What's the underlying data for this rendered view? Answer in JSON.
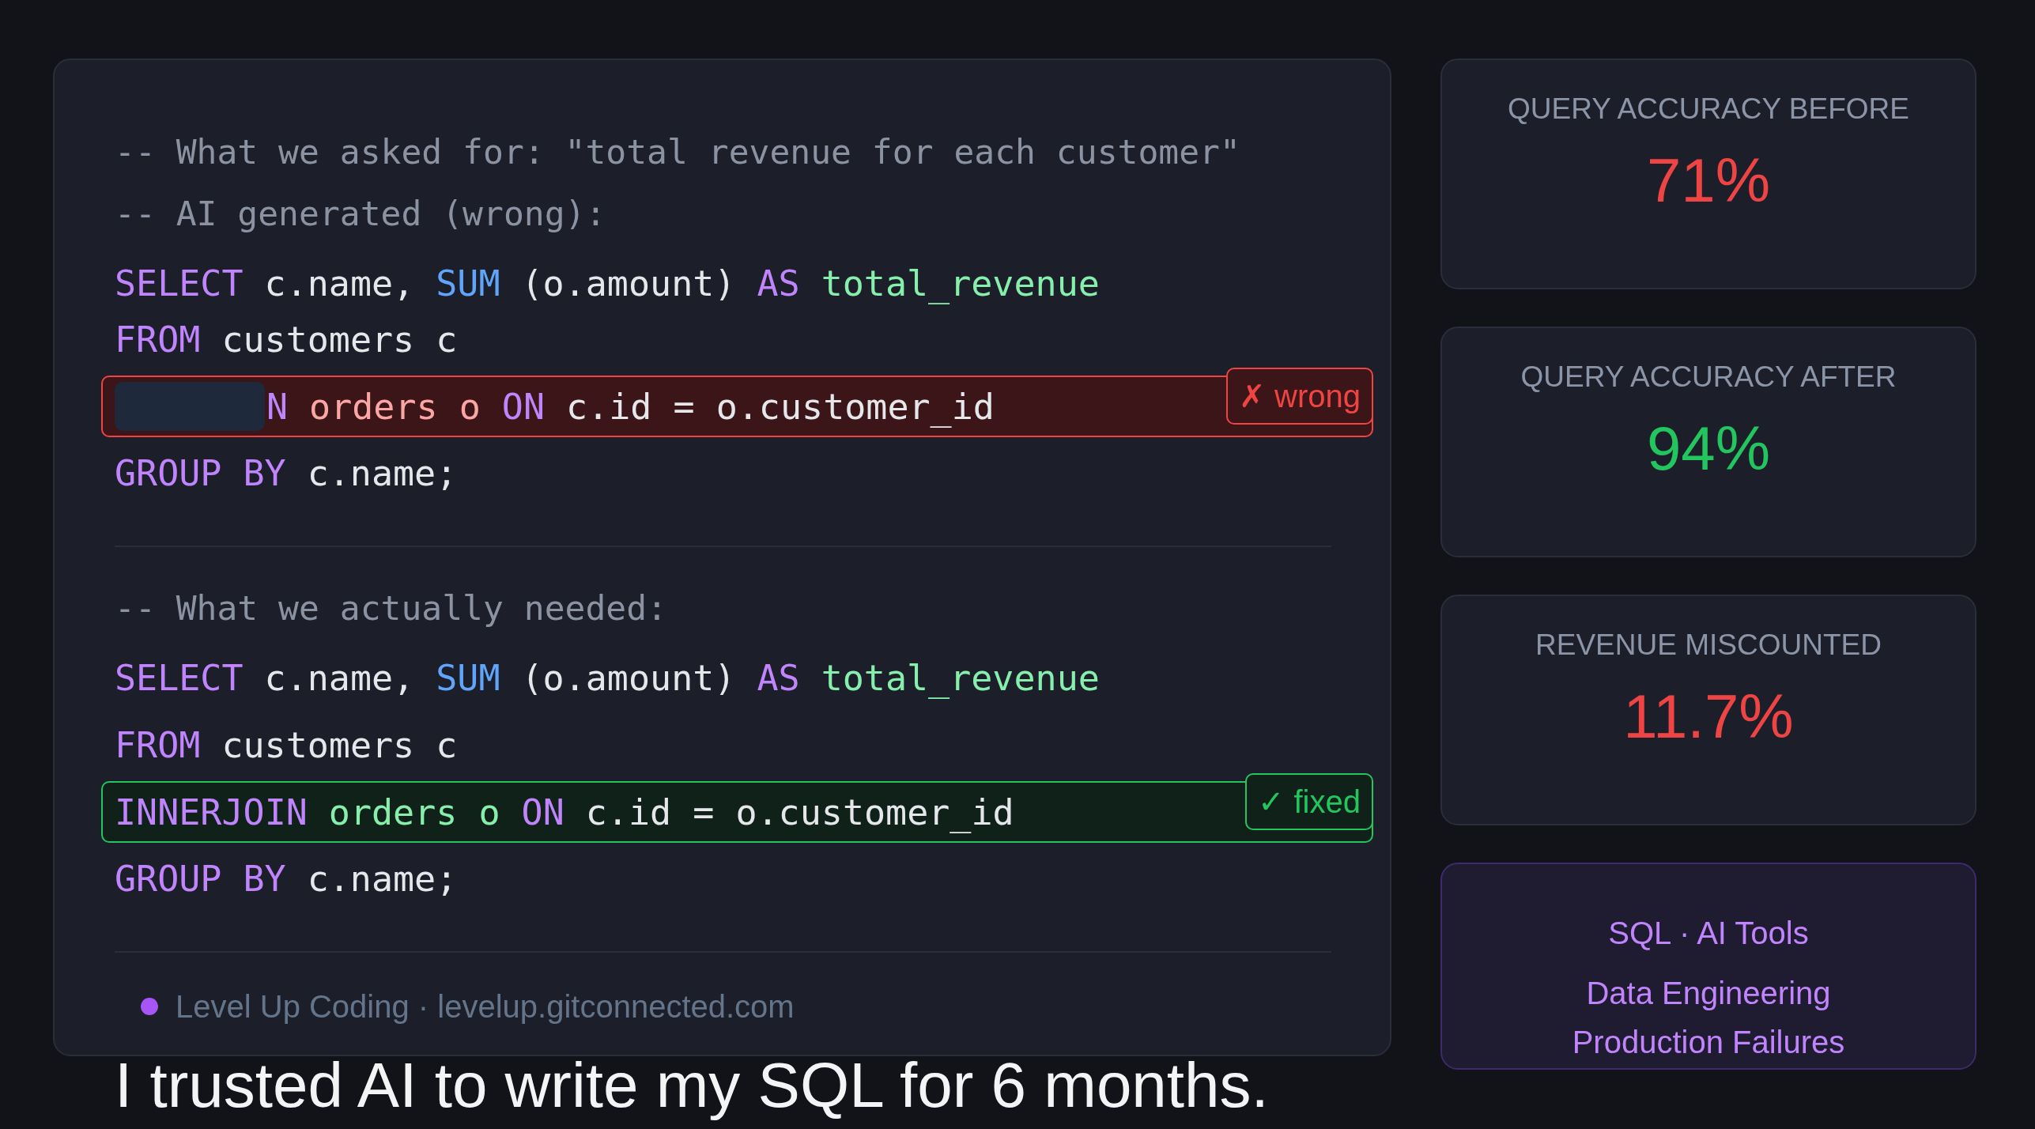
{
  "code_panel": {
    "sections": [
      {
        "lines": [
          {
            "kind": "comment",
            "text": "-- What we asked for: \"total revenue for each customer\""
          },
          {
            "kind": "comment",
            "text": "-- AI generated (wrong):"
          },
          {
            "kind": "code",
            "tokens": [
              {
                "text": "SELECT",
                "kind": "keyword"
              },
              {
                "text": "c.name,",
                "kind": "plain"
              },
              {
                "text": "SUM",
                "kind": "function"
              },
              {
                "text": "(o.amount)",
                "kind": "plain"
              },
              {
                "text": "AS",
                "kind": "keyword"
              },
              {
                "text": "total_revenue",
                "kind": "alias"
              }
            ]
          },
          {
            "kind": "code",
            "tokens": [
              {
                "text": "FROM",
                "kind": "keyword"
              },
              {
                "text": "customers c",
                "kind": "plain"
              }
            ]
          },
          {
            "kind": "highlight",
            "correct": false,
            "badge": "✗ wrong",
            "redacted": true,
            "tokens": [
              {
                "text": "N",
                "kind": "keyword"
              },
              {
                "text": "orders o",
                "kind": "error"
              },
              {
                "text": "ON",
                "kind": "keyword"
              },
              {
                "text": "c.id = o.customer_id",
                "kind": "plain"
              }
            ]
          },
          {
            "kind": "code",
            "tokens": [
              {
                "text": "GROUP",
                "kind": "keyword"
              },
              {
                "text": "BY",
                "kind": "keyword"
              },
              {
                "text": "c.name;",
                "kind": "plain"
              }
            ]
          }
        ]
      },
      {
        "lines": [
          {
            "kind": "comment",
            "text": "-- What we actually needed:"
          },
          {
            "kind": "code",
            "tokens": [
              {
                "text": "SELECT",
                "kind": "keyword"
              },
              {
                "text": "c.name,",
                "kind": "plain"
              },
              {
                "text": "SUM",
                "kind": "function"
              },
              {
                "text": "(o.amount)",
                "kind": "plain"
              },
              {
                "text": "AS",
                "kind": "keyword"
              },
              {
                "text": "total_revenue",
                "kind": "alias"
              }
            ]
          },
          {
            "kind": "code",
            "tokens": [
              {
                "text": "FROM",
                "kind": "keyword"
              },
              {
                "text": "customers c",
                "kind": "plain"
              }
            ]
          },
          {
            "kind": "highlight",
            "correct": true,
            "badge": "✓ fixed",
            "redacted": false,
            "tokens": [
              {
                "text": "INNERJOIN",
                "kind": "keyword"
              },
              {
                "text": "orders o",
                "kind": "alias"
              },
              {
                "text": "ON",
                "kind": "keyword"
              },
              {
                "text": "c.id = o.customer_id",
                "kind": "plain"
              }
            ]
          },
          {
            "kind": "code",
            "tokens": [
              {
                "text": "GROUP",
                "kind": "keyword"
              },
              {
                "text": "BY",
                "kind": "keyword"
              },
              {
                "text": "c.name;",
                "kind": "plain"
              }
            ]
          }
        ]
      }
    ],
    "footer": {
      "source": "Level Up Coding · levelup.gitconnected.com"
    }
  },
  "headline": "I trusted AI to write my SQL for 6 months.",
  "stats": [
    {
      "label": "QUERY ACCURACY BEFORE",
      "value": "71%",
      "kind": "negative"
    },
    {
      "label": "QUERY ACCURACY AFTER",
      "value": "94%",
      "kind": "positive"
    },
    {
      "label": "REVENUE MISCOUNTED",
      "value": "11.7%",
      "kind": "negative"
    }
  ],
  "tags": [
    "SQL · AI Tools",
    "Data Engineering",
    "Production Failures"
  ]
}
